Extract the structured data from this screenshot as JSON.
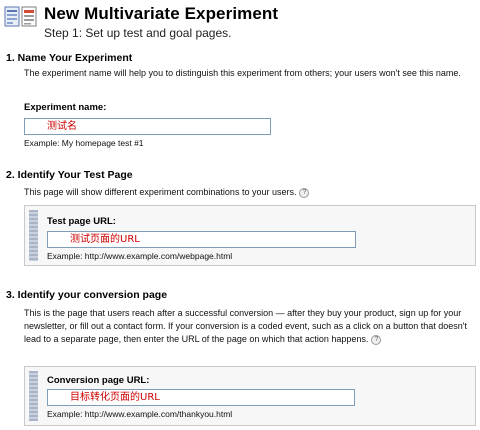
{
  "header": {
    "title": "New Multivariate Experiment",
    "subtitle": "Step 1: Set up test and goal pages."
  },
  "section1": {
    "title": "1. Name Your Experiment",
    "description": "The experiment name will help you to distinguish this experiment from others; your users won't see this name.",
    "field_label": "Experiment name:",
    "field_value": "测试名",
    "example": "Example: My homepage test #1"
  },
  "section2": {
    "title": "2. Identify Your Test Page",
    "description": "This page will show different experiment combinations to your users.",
    "help_icon": "?",
    "field_label": "Test page URL:",
    "field_value": "测试页面的URL",
    "example": "Example: http://www.example.com/webpage.html"
  },
  "section3": {
    "title": "3. Identify your conversion page",
    "description": "This is the page that users reach after a successful conversion — after they buy your product, sign up for your newsletter, or fill out a contact form. If your conversion is a coded event, such as a click on a button that doesn't lead to a separate page, then enter the URL of the page on which that action happens.",
    "help_icon": "?",
    "field_label": "Conversion page URL:",
    "field_value": "目标转化页面的URL",
    "example": "Example: http://www.example.com/thankyou.html"
  },
  "colors": {
    "input_text": "#cc0000",
    "input_border": "#7f9db9",
    "panel_bg": "#f7f7f7"
  }
}
